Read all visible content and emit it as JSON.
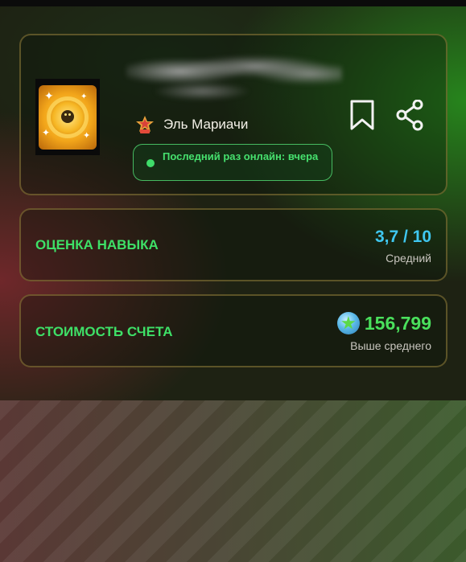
{
  "profile": {
    "brawler_name": "Эль Мариачи",
    "online_status": "Последний раз онлайн: вчера"
  },
  "skill": {
    "label": "ОЦЕНКА НАВЫКА",
    "score": "3,7 / 10",
    "rating": "Средний"
  },
  "account_value": {
    "label": "СТОИМОСТЬ СЧЕТА",
    "value": "156,799",
    "rating": "Выше среднего"
  },
  "colors": {
    "accent_green": "#3ee067",
    "score_blue": "#3fc7f0",
    "card_border": "#96823c"
  },
  "icons": {
    "bookmark": "bookmark-icon",
    "share": "share-icon",
    "gem": "gem-icon",
    "rank": "rank-badge-icon",
    "online": "online-dot-icon"
  }
}
